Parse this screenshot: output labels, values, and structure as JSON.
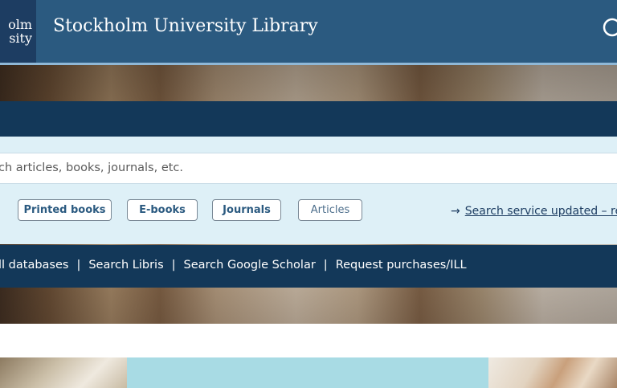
{
  "header": {
    "logo_line1": "olm",
    "logo_line2": "sity",
    "title": "Stockholm University Library",
    "search_icon": "search-icon"
  },
  "search": {
    "placeholder": "ch articles, books, journals, etc.",
    "chips": [
      "Printed books",
      "E-books",
      "Journals",
      "Articles"
    ],
    "update_link": "Search service updated – rea"
  },
  "links": [
    "ll databases",
    "Search Libris",
    "Search Google Scholar",
    "Request purchases/ILL"
  ],
  "colors": {
    "header": "#2b5a80",
    "dark_bar": "#133859",
    "panel": "#def0f7",
    "teal": "#a8dbe4"
  }
}
